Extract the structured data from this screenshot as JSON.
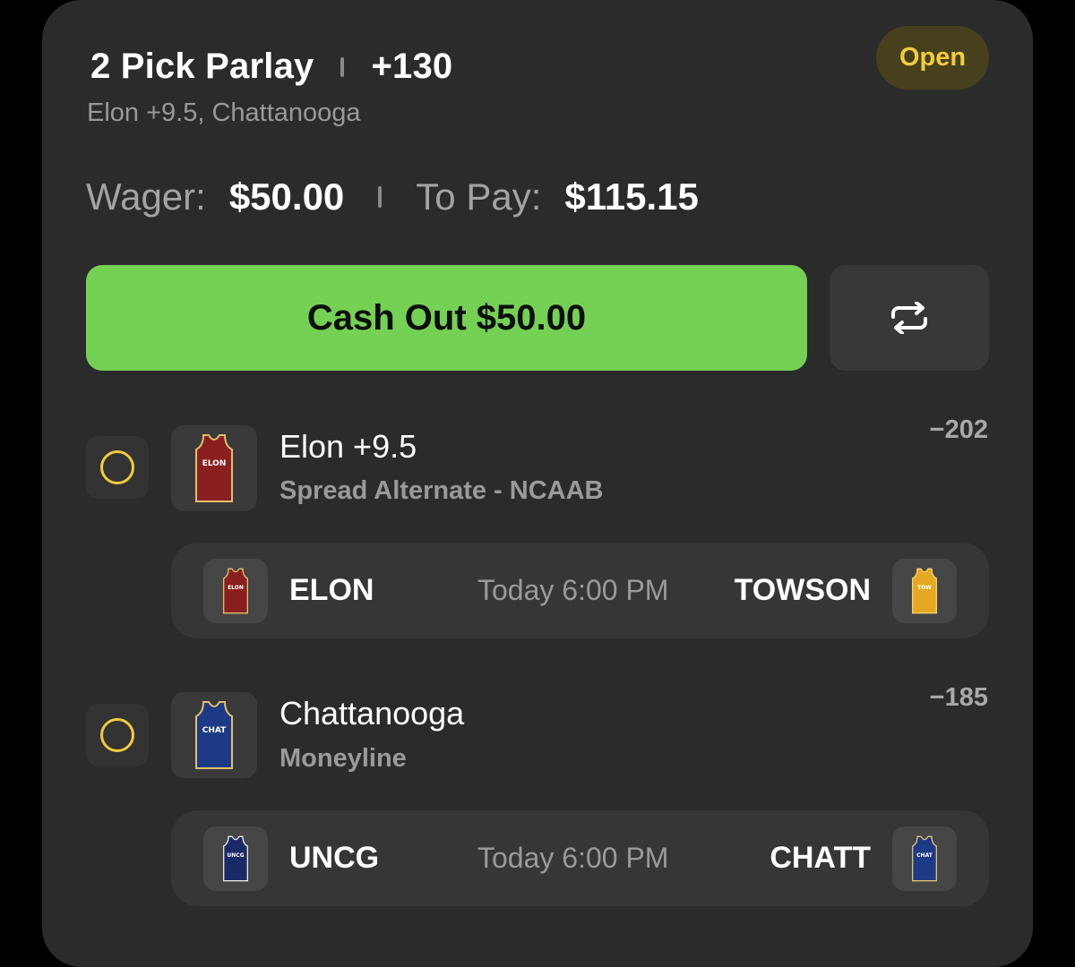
{
  "bet": {
    "title": "2 Pick Parlay",
    "odds": "+130",
    "subtitle": "Elon +9.5, Chattanooga",
    "status": "Open"
  },
  "wager": {
    "wager_label": "Wager:",
    "wager_value": "$50.00",
    "to_pay_label": "To Pay:",
    "to_pay_value": "$115.15"
  },
  "actions": {
    "cash_out_label": "Cash Out $50.00",
    "refresh_icon": "refresh-icon"
  },
  "picks": [
    {
      "name": "Elon +9.5",
      "market": "Spread Alternate - NCAAB",
      "odds": "−202",
      "jersey": {
        "text": "ELON",
        "color": "#8a1f1f",
        "trim": "#e0c06b"
      },
      "matchup": {
        "away": "ELON",
        "away_jersey": {
          "text": "ELON",
          "color": "#8a1f1f",
          "trim": "#e0c06b"
        },
        "time": "Today 6:00 PM",
        "home": "TOWSON",
        "home_jersey": {
          "text": "TOW",
          "color": "#e5a823",
          "trim": "#f5d36a"
        }
      }
    },
    {
      "name": "Chattanooga",
      "market": "Moneyline",
      "odds": "−185",
      "jersey": {
        "text": "CHAT",
        "color": "#1d3a86",
        "trim": "#e0c06b"
      },
      "matchup": {
        "away": "UNCG",
        "away_jersey": {
          "text": "UNCG",
          "color": "#1a2a66",
          "trim": "#e8e8e8"
        },
        "time": "Today 6:00 PM",
        "home": "CHATT",
        "home_jersey": {
          "text": "CHAT",
          "color": "#1d3a86",
          "trim": "#e0c06b"
        }
      }
    }
  ],
  "colors": {
    "background": "#000000",
    "card": "#2b2b2b",
    "accent_green": "#74d153",
    "open_badge_text": "#f2cc3c",
    "open_badge_bg": "#47401d"
  }
}
